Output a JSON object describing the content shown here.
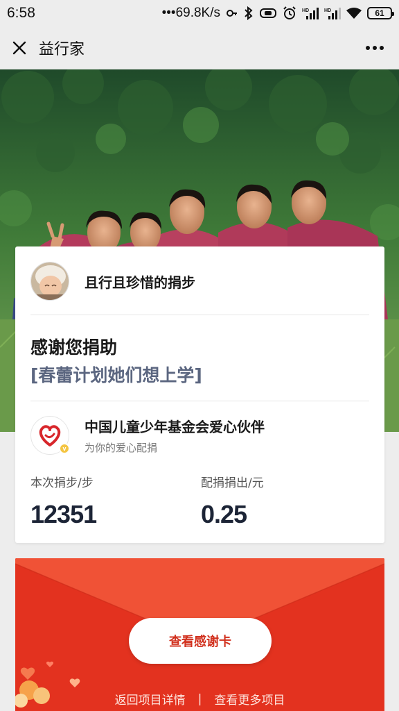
{
  "status_bar": {
    "time": "6:58",
    "net_speed": "•••69.8K/s",
    "battery": "61",
    "icons": [
      "key-icon",
      "bluetooth-icon",
      "vibrate-icon",
      "alarm-icon",
      "hd-signal-icon",
      "hd-signal-icon",
      "wifi-icon",
      "battery-icon"
    ]
  },
  "nav": {
    "title": "益行家",
    "close_icon": "close-icon",
    "more_icon": "more-icon"
  },
  "donor": {
    "name": "且行且珍惜的捐步"
  },
  "thanks": {
    "title": "感谢您捐助",
    "project": "[春蕾计划她们想上学]"
  },
  "partner": {
    "name": "中国儿童少年基金会爱心伙伴",
    "subtitle": "为你的爱心配捐",
    "badge": "v"
  },
  "stats": {
    "steps_label": "本次捐步/步",
    "steps_value": "12351",
    "amount_label": "配捐捐出/元",
    "amount_value": "0.25"
  },
  "envelope": {
    "button_label": "查看感谢卡",
    "link_back": "返回项目详情",
    "separator": "|",
    "link_more": "查看更多项目"
  },
  "colors": {
    "envelope_red": "#e3321f",
    "button_text": "#d1301d",
    "project_text": "#5b6680",
    "stat_value": "#1c2436"
  }
}
